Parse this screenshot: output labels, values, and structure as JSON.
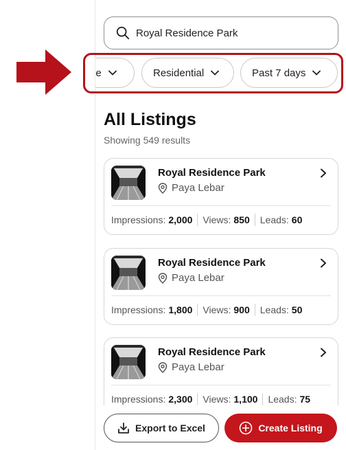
{
  "search": {
    "value": "Royal Residence Park",
    "icon": "search-icon"
  },
  "filters": [
    {
      "label": "le"
    },
    {
      "label": "Residential"
    },
    {
      "label": "Past 7 days"
    }
  ],
  "listings_section": {
    "title": "All Listings",
    "count_text": "Showing 549 results"
  },
  "listings": [
    {
      "title": "Royal Residence Park",
      "location": "Paya Lebar",
      "impressions_label": "Impressions:",
      "impressions": "2,000",
      "views_label": "Views:",
      "views": "850",
      "leads_label": "Leads:",
      "leads": "60"
    },
    {
      "title": "Royal Residence Park",
      "location": "Paya Lebar",
      "impressions_label": "Impressions:",
      "impressions": "1,800",
      "views_label": "Views:",
      "views": "900",
      "leads_label": "Leads:",
      "leads": "50"
    },
    {
      "title": "Royal Residence Park",
      "location": "Paya Lebar",
      "impressions_label": "Impressions:",
      "impressions": "2,300",
      "views_label": "Views:",
      "views": "1,100",
      "leads_label": "Leads:",
      "leads": "75"
    }
  ],
  "actions": {
    "export_label": "Export to Excel",
    "create_label": "Create Listing"
  },
  "colors": {
    "accent": "#c4161c",
    "annotation": "#b5121b"
  }
}
